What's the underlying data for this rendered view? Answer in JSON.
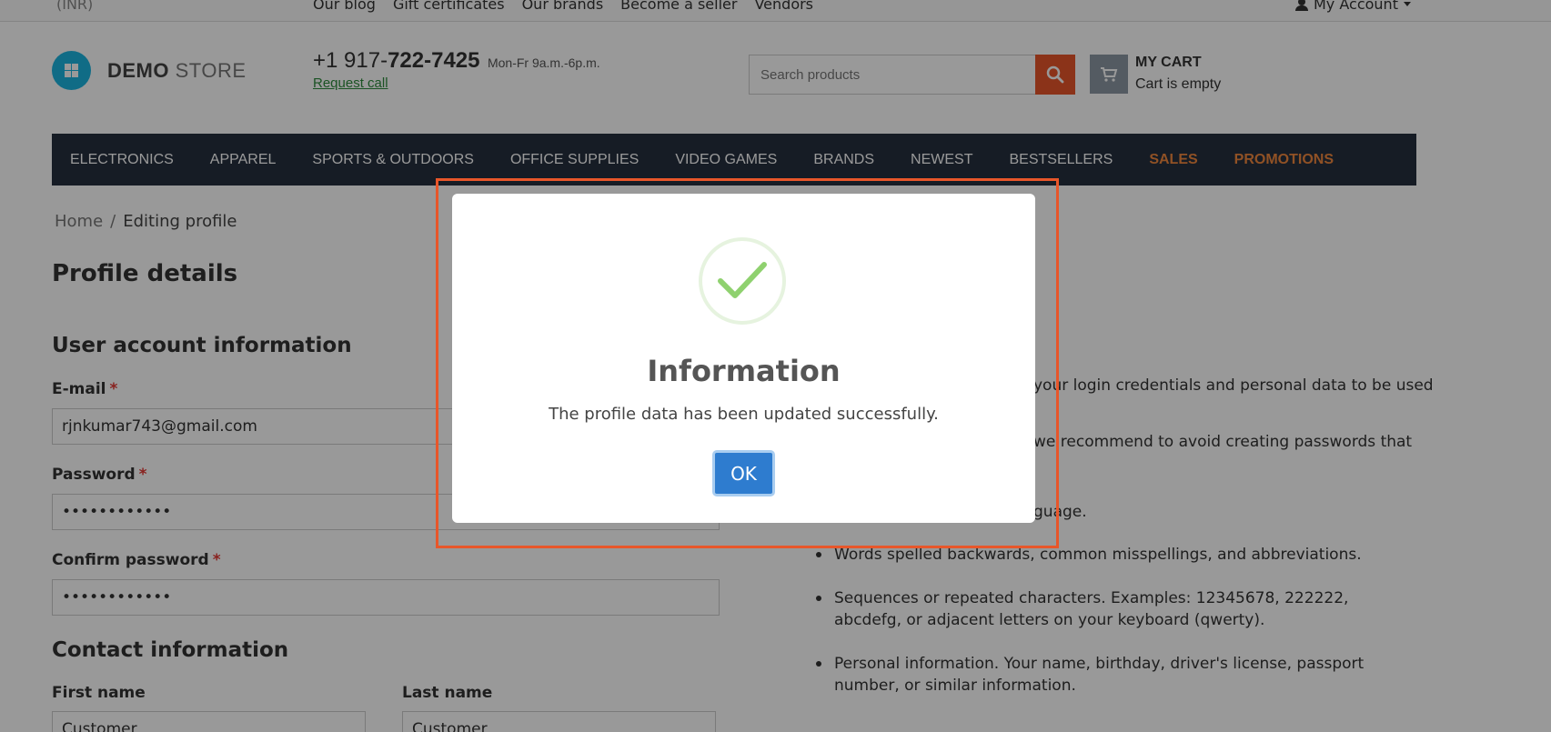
{
  "topbar": {
    "currency": "(INR)",
    "links": [
      "Our blog",
      "Gift certificates",
      "Our brands",
      "Become a seller",
      "Vendors"
    ],
    "account": "My Account"
  },
  "header": {
    "logo_bold": "DEMO",
    "logo_light": "STORE",
    "phone_prefix": "+1 917-",
    "phone_bold": "722-7425",
    "hours": "Mon-Fr 9a.m.-6p.m.",
    "request_call": "Request call",
    "search_placeholder": "Search products",
    "cart_title": "MY CART",
    "cart_status": "Cart is empty"
  },
  "nav": {
    "items": [
      "ELECTRONICS",
      "APPAREL",
      "SPORTS & OUTDOORS",
      "OFFICE SUPPLIES",
      "VIDEO GAMES",
      "BRANDS",
      "NEWEST",
      "BESTSELLERS"
    ],
    "hot_items": [
      "SALES",
      "PROMOTIONS"
    ]
  },
  "breadcrumb": {
    "home": "Home",
    "sep": "/",
    "current": "Editing profile"
  },
  "page": {
    "title": "Profile details",
    "user_section": "User account information",
    "email_label": "E-mail",
    "email_value": "rjnkumar743@gmail.com",
    "password_label": "Password",
    "password_value": "••••••••••••",
    "confirm_label": "Confirm password",
    "confirm_value": "••••••••••••",
    "required_mark": "*",
    "contact_section": "Contact information",
    "first_name_label": "First name",
    "first_name_value": "Customer",
    "last_name_label": "Last name",
    "last_name_value": "Customer"
  },
  "tips": {
    "line1": "your login credentials and personal data to be used",
    "line2a": "we recommend to avoid creating passwords that",
    "line3": "guage.",
    "bullets": [
      "Words spelled backwards, common misspellings, and abbreviations.",
      "Sequences or repeated characters. Examples: 12345678, 222222, abcdefg, or adjacent letters on your keyboard (qwerty).",
      "Personal information. Your name, birthday, driver's license, passport number, or similar information."
    ]
  },
  "modal": {
    "title": "Information",
    "message": "The profile data has been updated successfully.",
    "ok": "OK"
  },
  "colors": {
    "accent": "#e8562a",
    "nav_bg": "#26303f",
    "ok_button": "#2e7ccf",
    "check": "#8fd16f"
  }
}
